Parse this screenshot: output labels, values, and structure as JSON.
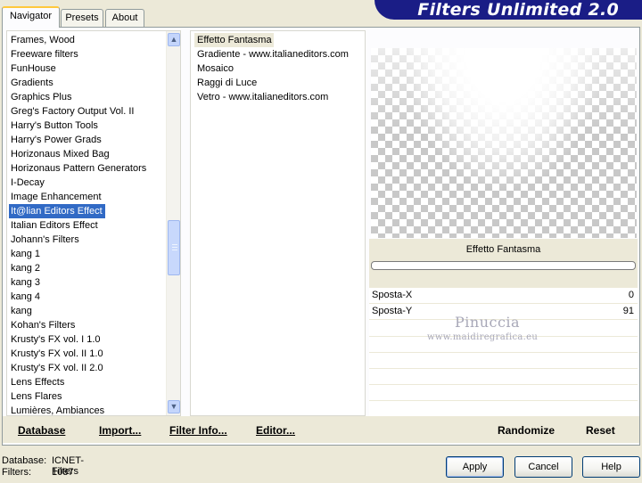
{
  "tabs": [
    {
      "label": "Navigator"
    },
    {
      "label": "Presets"
    },
    {
      "label": "About"
    }
  ],
  "banner": {
    "title": "Filters Unlimited 2.0"
  },
  "categories": [
    "Frames, Wood",
    "Freeware filters",
    "FunHouse",
    "Gradients",
    "Graphics Plus",
    "Greg's Factory Output Vol. II",
    "Harry's Button Tools",
    "Harry's Power Grads",
    "Horizonaus Mixed Bag",
    "Horizonaus Pattern Generators",
    "I-Decay",
    "Image Enhancement",
    "It@lian Editors Effect",
    "Italian Editors Effect",
    "Johann's Filters",
    "kang 1",
    "kang 2",
    "kang 3",
    "kang 4",
    "kang",
    "Kohan's Filters",
    "Krusty's FX vol. I 1.0",
    "Krusty's FX vol. II 1.0",
    "Krusty's FX vol. II 2.0",
    "Lens Effects",
    "Lens Flares",
    "Lumières, Ambiances"
  ],
  "selected_category": "It@lian Editors Effect",
  "filters": [
    "Effetto Fantasma",
    "Gradiente - www.italianeditors.com",
    "Mosaico",
    "Raggi di Luce",
    "Vetro - www.italianeditors.com"
  ],
  "selected_filter": "Effetto Fantasma",
  "controls": {
    "filter_title": "Effetto Fantasma",
    "params": [
      {
        "label": "Sposta-X",
        "value": "0"
      },
      {
        "label": "Sposta-Y",
        "value": "91"
      }
    ]
  },
  "watermark": {
    "name": "Pinuccia",
    "site": "www.maidiregrafica.eu"
  },
  "bottom_links": {
    "database": "Database",
    "import": "Import...",
    "filter_info": "Filter Info...",
    "editor": "Editor...",
    "randomize": "Randomize",
    "reset": "Reset"
  },
  "status": {
    "database_label": "Database:",
    "database_value": "ICNET-Filters",
    "filters_label": "Filters:",
    "filters_value": "1087"
  },
  "buttons": {
    "apply": "Apply",
    "cancel": "Cancel",
    "help": "Help"
  },
  "colors": {
    "selection": "#316ac5",
    "banner": "#1a1d86",
    "face": "#ece9d8"
  }
}
